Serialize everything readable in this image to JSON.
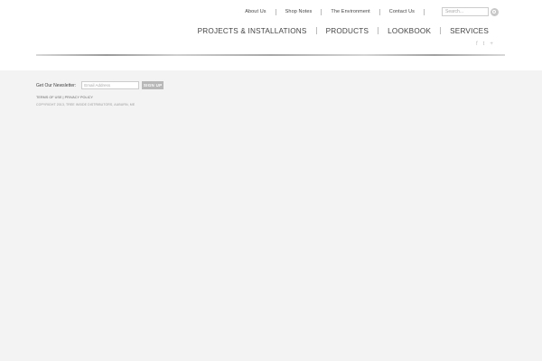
{
  "utility_nav": {
    "items": [
      "About Us",
      "Shop Notes",
      "The Environment",
      "Contact Us"
    ]
  },
  "search": {
    "placeholder": "Search..."
  },
  "main_nav": {
    "items": [
      "PROJECTS & INSTALLATIONS",
      "PRODUCTS",
      "LOOKBOOK",
      "SERVICES"
    ]
  },
  "social": {
    "icons": [
      "facebook-icon",
      "twitter-icon",
      "plus-icon"
    ],
    "glyphs": [
      "f",
      "t",
      "+"
    ]
  },
  "footer": {
    "newsletter_label": "Get Our Newsletter:",
    "email_placeholder": "Email Address",
    "signup_label": "SIGN UP",
    "terms_label": "TERMS OF USE",
    "legal_sep": "|",
    "privacy_label": "PRIVACY POLICY",
    "copyright": "COPYRIGHT 2013, TREE INSIDE DISTRIBUTORS, AUBURN, ME"
  },
  "colors": {
    "background": "#f3f3f3",
    "header": "#ffffff",
    "button": "#b8b8b8"
  }
}
